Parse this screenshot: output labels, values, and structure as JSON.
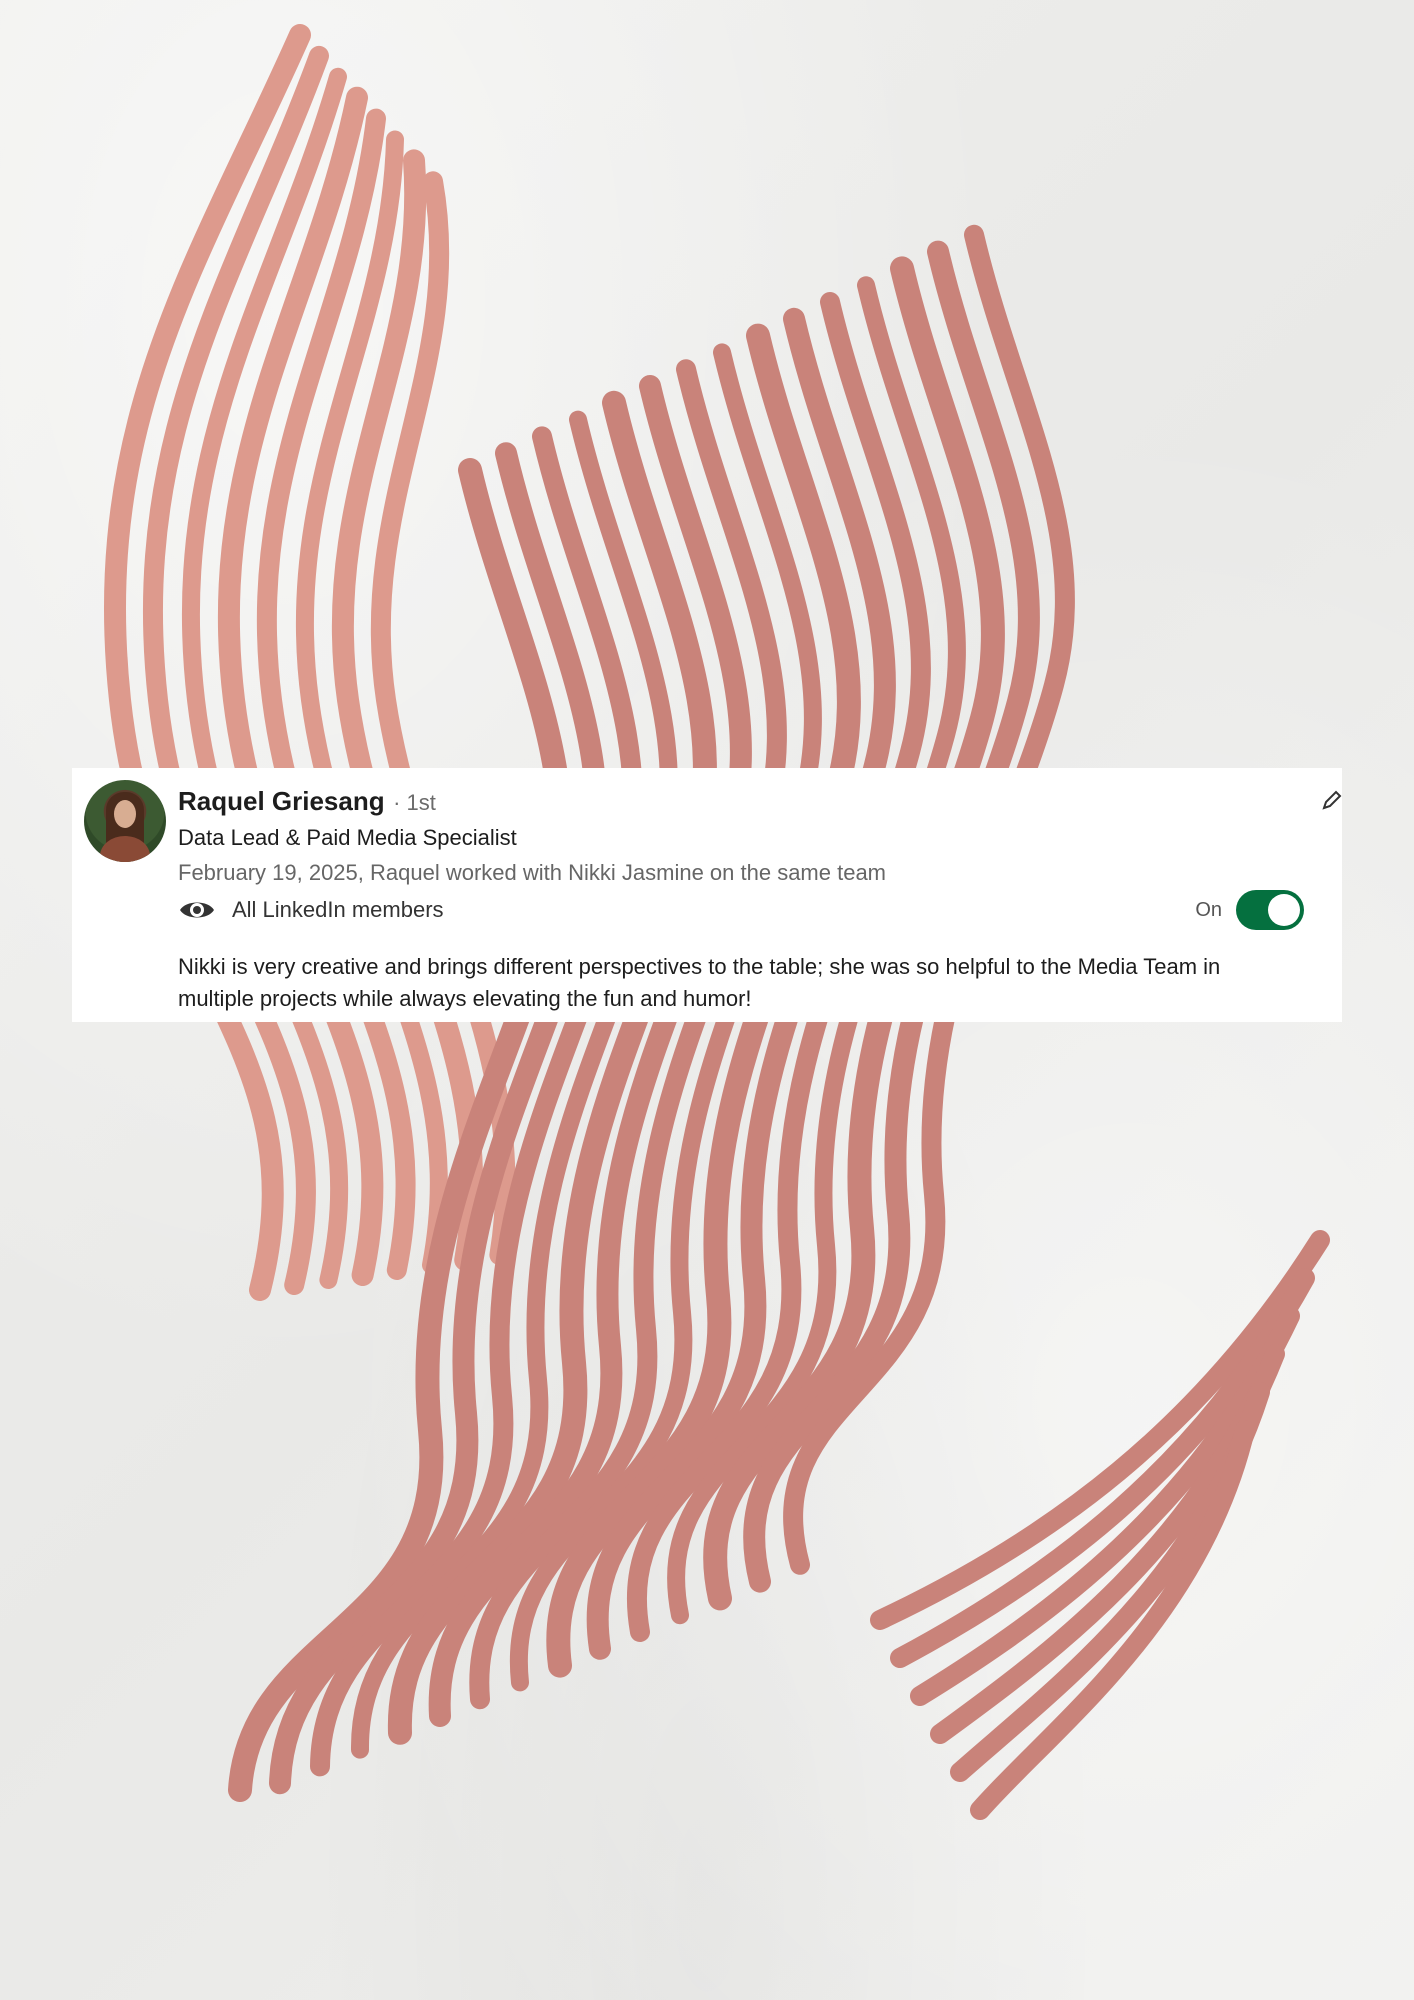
{
  "background": {
    "paper_color": "#ededeb",
    "stroke_color_light": "#dd9a8d",
    "stroke_color_dark": "#c9837a"
  },
  "recommendation": {
    "name": "Raquel Griesang",
    "degree": "· 1st",
    "headline": "Data Lead & Paid Media Specialist",
    "relation": "February 19, 2025, Raquel worked with Nikki Jasmine on the same team",
    "visibility_label": "All LinkedIn members",
    "toggle_state": "On",
    "toggle_color": "#05703f",
    "text": "Nikki is very creative and brings different perspectives to the table; she was so helpful to the Media Team in multiple projects while always elevating the fun and humor!",
    "icons": {
      "visibility": "eye-icon",
      "edit": "pencil-icon"
    }
  }
}
